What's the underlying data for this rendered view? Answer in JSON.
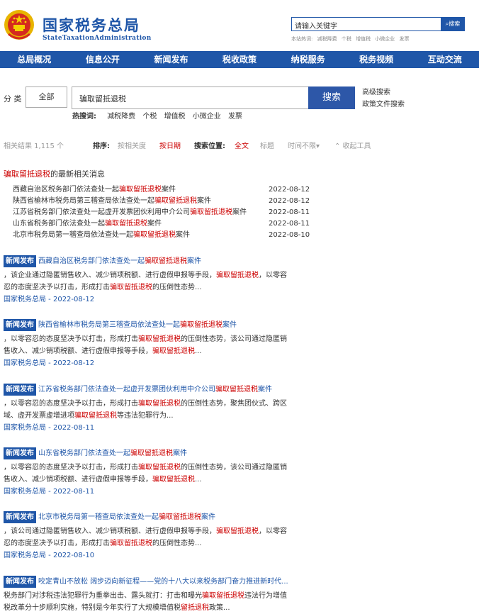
{
  "header": {
    "logo_cn": "国家税务总局",
    "logo_en": "StateTaxationAdministration",
    "search_placeholder": "请输入关键字",
    "search_button": "搜索",
    "hot_label": "本站热词:",
    "hot_words": [
      "减税降费",
      "个税",
      "增值税",
      "小微企业",
      "发票"
    ]
  },
  "nav": [
    "总局概况",
    "信息公开",
    "新闻发布",
    "税收政策",
    "纳税服务",
    "税务视频",
    "互动交流"
  ],
  "search": {
    "category_label": "分 类",
    "category_value": "全部",
    "query": "骗取留抵退税",
    "button": "搜索",
    "advanced": "高级搜索",
    "policy": "政策文件搜索",
    "hotwords_label": "热搜词:",
    "hotwords": [
      "减税降费",
      "个税",
      "增值税",
      "小微企业",
      "发票"
    ]
  },
  "sort": {
    "count_text": "相关结果 1,115 个",
    "sort_label": "排序:",
    "by_relevance": "按相关度",
    "by_date": "按日期",
    "position_label": "搜索位置:",
    "pos_all": "全文",
    "pos_title": "标题",
    "time_limit": "时间不限▾",
    "collapse_tools": "⌃ 收起工具"
  },
  "latest": {
    "keyword": "骗取留抵退税",
    "suffix": "的最新相关消息",
    "items": [
      {
        "pre": "西藏自治区税务部门依法查处一起",
        "kw": "骗取留抵退税",
        "post": "案件",
        "date": "2022-08-12"
      },
      {
        "pre": "陕西省榆林市税务局第三稽查局依法查处一起",
        "kw": "骗取留抵退税",
        "post": "案件",
        "date": "2022-08-12"
      },
      {
        "pre": "江苏省税务部门依法查处一起虚开发票团伙利用中介公司",
        "kw": "骗取留抵退税",
        "post": "案件",
        "date": "2022-08-11"
      },
      {
        "pre": "山东省税务部门依法查处一起",
        "kw": "骗取留抵退税",
        "post": "案件",
        "date": "2022-08-11"
      },
      {
        "pre": "北京市税务局第一稽查局依法查处一起",
        "kw": "骗取留抵退税",
        "post": "案件",
        "date": "2022-08-10"
      }
    ]
  },
  "results": [
    {
      "tag": "新闻发布",
      "title_pre": "西藏自治区税务部门依法查处一起",
      "title_kw": "骗取留抵退税",
      "title_post": "案件",
      "l1_pre": "，该企业通过隐匿销售收入、减少销项税额、进行虚假申报等手段，",
      "l1_kw": "骗取留抵退税",
      "l1_post": "，以零容",
      "l2_pre": "忍的态度坚决予以打击，形成打击",
      "l2_kw": "骗取留抵退税",
      "l2_post": "的压倒性态势...",
      "source": "国家税务总局 - 2022-08-12"
    },
    {
      "tag": "新闻发布",
      "title_pre": "陕西省榆林市税务局第三稽查局依法查处一起",
      "title_kw": "骗取留抵退税",
      "title_post": "案件",
      "l1_pre": "，以零容忍的态度坚决予以打击，形成打击",
      "l1_kw": "骗取留抵退税",
      "l1_post": "的压倒性态势，该公司通过隐匿销",
      "l2_pre": "售收入、减少销项税额、进行虚假申报等手段，",
      "l2_kw": "骗取留抵退税",
      "l2_post": "...",
      "source": "国家税务总局 - 2022-08-12"
    },
    {
      "tag": "新闻发布",
      "title_pre": "江苏省税务部门依法查处一起虚开发票团伙利用中介公司",
      "title_kw": "骗取留抵退税",
      "title_post": "案件",
      "l1_pre": "，以零容忍的态度坚决予以打击，形成打击",
      "l1_kw": "骗取留抵退税",
      "l1_post": "的压倒性态势，聚焦团伙式、跨区",
      "l2_pre": "域、虚开发票虚增进项",
      "l2_kw": "骗取留抵退税",
      "l2_post": "等违法犯罪行为...",
      "source": "国家税务总局 - 2022-08-11"
    },
    {
      "tag": "新闻发布",
      "title_pre": "山东省税务部门依法查处一起",
      "title_kw": "骗取留抵退税",
      "title_post": "案件",
      "l1_pre": "，以零容忍的态度坚决予以打击，形成打击",
      "l1_kw": "骗取留抵退税",
      "l1_post": "的压倒性态势，该公司通过隐匿销",
      "l2_pre": "售收入、减少销项税额、进行虚假申报等手段，",
      "l2_kw": "骗取留抵退税",
      "l2_post": "...",
      "source": "国家税务总局 - 2022-08-11"
    },
    {
      "tag": "新闻发布",
      "title_pre": "北京市税务局第一稽查局依法查处一起",
      "title_kw": "骗取留抵退税",
      "title_post": "案件",
      "l1_pre": "，该公司通过隐匿销售收入、减少销项税额、进行虚假申报等手段，",
      "l1_kw": "骗取留抵退税",
      "l1_post": "，以零容",
      "l2_pre": "忍的态度坚决予以打击，形成打击",
      "l2_kw": "骗取留抵退税",
      "l2_post": "的压倒性态势...",
      "source": "国家税务总局 - 2022-08-10"
    },
    {
      "tag": "新闻发布",
      "title_pre": "咬定青山不放松 阔步迈向新征程——党的十八大以来税务部门奋力推进新时代...",
      "title_kw": "",
      "title_post": "",
      "l1_pre": "税务部门对涉税违法犯罪行为重拳出击、露头就打：打击和曝光",
      "l1_kw": "骗取留抵退税",
      "l1_post": "违法行为增值",
      "l2_pre": "税改革分十步顺利实施，特别是今年实行了大规模增值税",
      "l2_kw": "留抵退税",
      "l2_post": "政策...",
      "source": ""
    }
  ],
  "colors": {
    "brand": "#1f56a8",
    "highlight": "#c00000"
  }
}
